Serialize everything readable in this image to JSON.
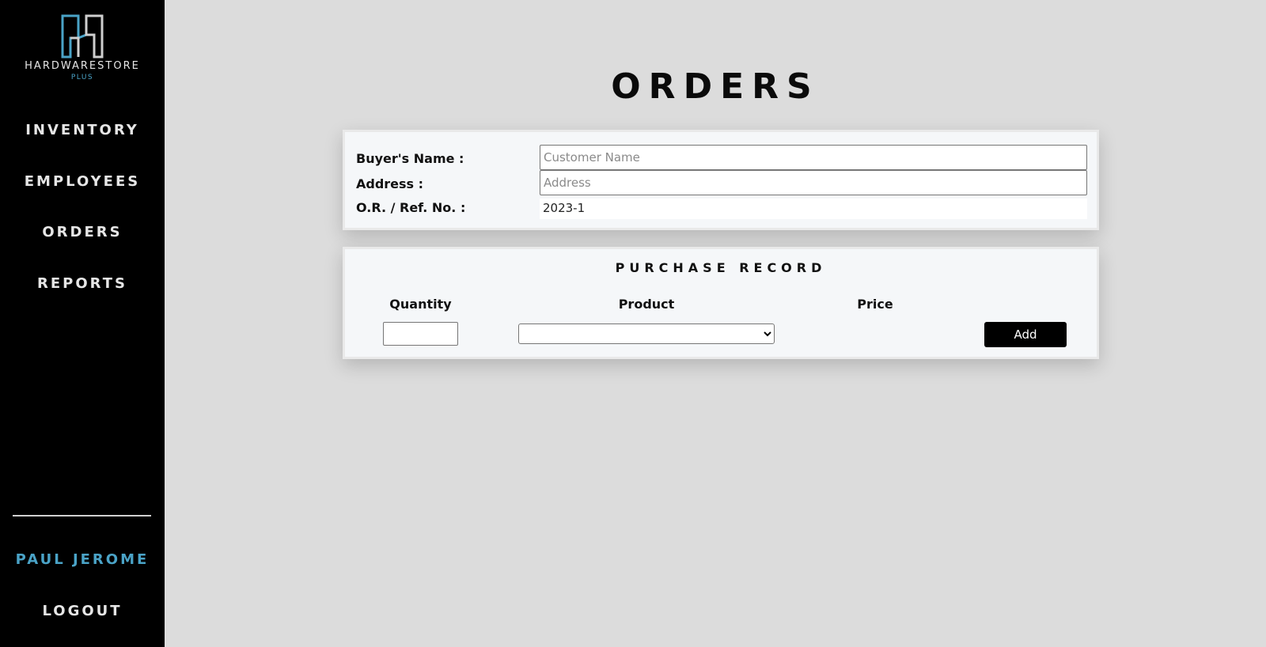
{
  "brand": {
    "name": "HARDWARESTORE",
    "tagline": "PLUS",
    "logo_icon": "hardwarestore-h-logo-icon",
    "accent_color": "#4aa3c7"
  },
  "sidebar": {
    "items": [
      {
        "label": "INVENTORY"
      },
      {
        "label": "EMPLOYEES"
      },
      {
        "label": "ORDERS"
      },
      {
        "label": "REPORTS"
      }
    ],
    "user_name": "PAUL JEROME",
    "logout_label": "LOGOUT"
  },
  "page": {
    "title": "ORDERS"
  },
  "order_info": {
    "buyer_label": "Buyer's Name :",
    "buyer_value": "",
    "buyer_placeholder": "Customer Name",
    "address_label": "Address :",
    "address_value": "",
    "address_placeholder": "Address",
    "ref_label": "O.R. / Ref. No. :",
    "ref_value": "2023-1"
  },
  "purchase_record": {
    "title": "PURCHASE RECORD",
    "columns": {
      "quantity": "Quantity",
      "product": "Product",
      "price": "Price"
    },
    "quantity_value": "",
    "product_selected": "",
    "add_label": "Add"
  }
}
